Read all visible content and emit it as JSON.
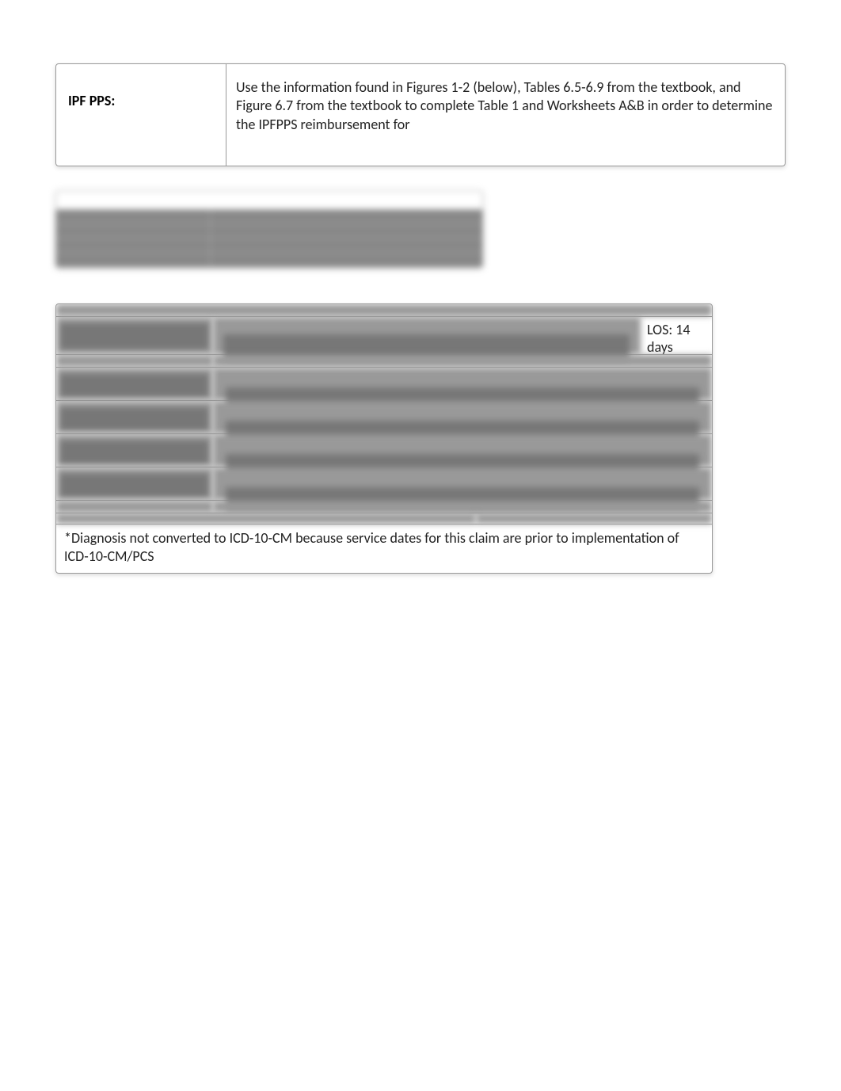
{
  "section1": {
    "label": "IPF PPS:",
    "description": "Use the information found in Figures 1-2 (below), Tables 6.5-6.9 from the textbook, and Figure 6.7 from the textbook to complete Table 1 and Worksheets A&B in order to determine the IPFPPS reimbursement for"
  },
  "section3": {
    "los_label": "LOS: 14 days",
    "footer_note": "*Diagnosis not converted to ICD-10-CM because service dates for this claim are prior to implementation of ICD-10-CM/PCS"
  }
}
